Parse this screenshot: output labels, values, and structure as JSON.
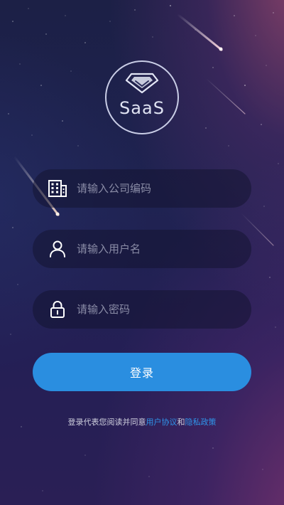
{
  "logo": {
    "text": "SaaS",
    "icon": "diamond-icon"
  },
  "form": {
    "company_code": {
      "placeholder": "请输入公司编码",
      "value": "",
      "icon": "building-icon"
    },
    "username": {
      "placeholder": "请输入用户名",
      "value": "",
      "icon": "user-icon"
    },
    "password": {
      "placeholder": "请输入密码",
      "value": "",
      "icon": "lock-icon"
    },
    "login_label": "登录"
  },
  "agreement": {
    "prefix": "登录代表您阅读并同意",
    "user_agreement": "用户协议",
    "conjunction": "和",
    "privacy_policy": "隐私政策"
  },
  "colors": {
    "accent": "#2a8ee0",
    "link": "#2f95ea"
  }
}
